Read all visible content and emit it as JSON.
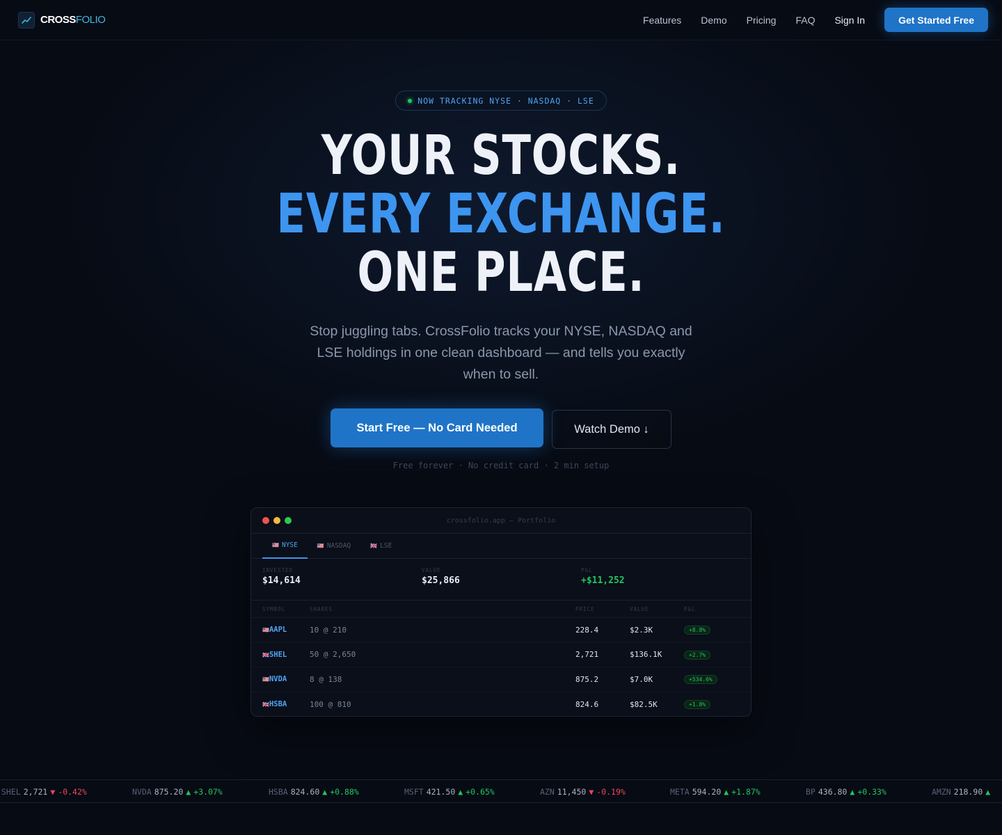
{
  "nav": {
    "logo_bold": "CROSS",
    "logo_light": "FOLIO",
    "links": [
      "Features",
      "Demo",
      "Pricing",
      "FAQ"
    ],
    "signin": "Sign In",
    "cta": "Get Started Free"
  },
  "hero": {
    "badge": "NOW TRACKING NYSE · NASDAQ · LSE",
    "line1": "YOUR STOCKS.",
    "line2": "EVERY EXCHANGE.",
    "line3": "ONE PLACE.",
    "subtitle": "Stop juggling tabs. CrossFolio tracks your NYSE, NASDAQ and LSE holdings in one clean dashboard — and tells you exactly when to sell.",
    "primary_cta": "Start Free — No Card Needed",
    "secondary_cta": "Watch Demo ↓",
    "fine_print": "Free forever · No credit card · 2 min setup"
  },
  "preview": {
    "window_title": "crossfolio.app — Portfolio",
    "tabs": [
      {
        "flag": "🇺🇸",
        "label": "NYSE",
        "active": true
      },
      {
        "flag": "🇺🇸",
        "label": "NASDAQ",
        "active": false
      },
      {
        "flag": "🇬🇧",
        "label": "LSE",
        "active": false
      }
    ],
    "stats": {
      "invested_label": "INVESTED",
      "invested": "$14,614",
      "value_label": "VALUE",
      "value": "$25,866",
      "pnl_label": "P&L",
      "pnl": "+$11,252"
    },
    "columns": {
      "symbol": "SYMBOL",
      "shares": "SHARES",
      "price": "PRICE",
      "value": "VALUE",
      "pnl": "P&L"
    },
    "rows": [
      {
        "flag": "🇺🇸",
        "symbol": "AAPL",
        "shares": "10 @ 210",
        "price": "228.4",
        "value": "$2.3K",
        "pnl": "+8.8%"
      },
      {
        "flag": "🇬🇧",
        "symbol": "SHEL",
        "shares": "50 @ 2,650",
        "price": "2,721",
        "value": "$136.1K",
        "pnl": "+2.7%"
      },
      {
        "flag": "🇺🇸",
        "symbol": "NVDA",
        "shares": "8 @ 138",
        "price": "875.2",
        "value": "$7.0K",
        "pnl": "+534.6%"
      },
      {
        "flag": "🇬🇧",
        "symbol": "HSBA",
        "shares": "100 @ 810",
        "price": "824.6",
        "value": "$82.5K",
        "pnl": "+1.8%"
      }
    ]
  },
  "ticker": [
    {
      "symbol": "SHEL",
      "price": "2,721",
      "arrow": "▼",
      "change": "-0.42%",
      "direction": "down"
    },
    {
      "symbol": "NVDA",
      "price": "875.20",
      "arrow": "▲",
      "change": "+3.07%",
      "direction": "up"
    },
    {
      "symbol": "HSBA",
      "price": "824.60",
      "arrow": "▲",
      "change": "+0.88%",
      "direction": "up"
    },
    {
      "symbol": "MSFT",
      "price": "421.50",
      "arrow": "▲",
      "change": "+0.65%",
      "direction": "up"
    },
    {
      "symbol": "AZN",
      "price": "11,450",
      "arrow": "▼",
      "change": "-0.19%",
      "direction": "down"
    },
    {
      "symbol": "META",
      "price": "594.20",
      "arrow": "▲",
      "change": "+1.87%",
      "direction": "up"
    },
    {
      "symbol": "BP",
      "price": "436.80",
      "arrow": "▲",
      "change": "+0.33%",
      "direction": "up"
    },
    {
      "symbol": "AMZN",
      "price": "218.90",
      "arrow": "▲",
      "change": "",
      "direction": "up"
    }
  ],
  "colors": {
    "accent": "#1f74c7",
    "headline_blue": "#3d95f0",
    "positive": "#22c55e",
    "negative": "#ef4458",
    "background": "#070b14"
  }
}
